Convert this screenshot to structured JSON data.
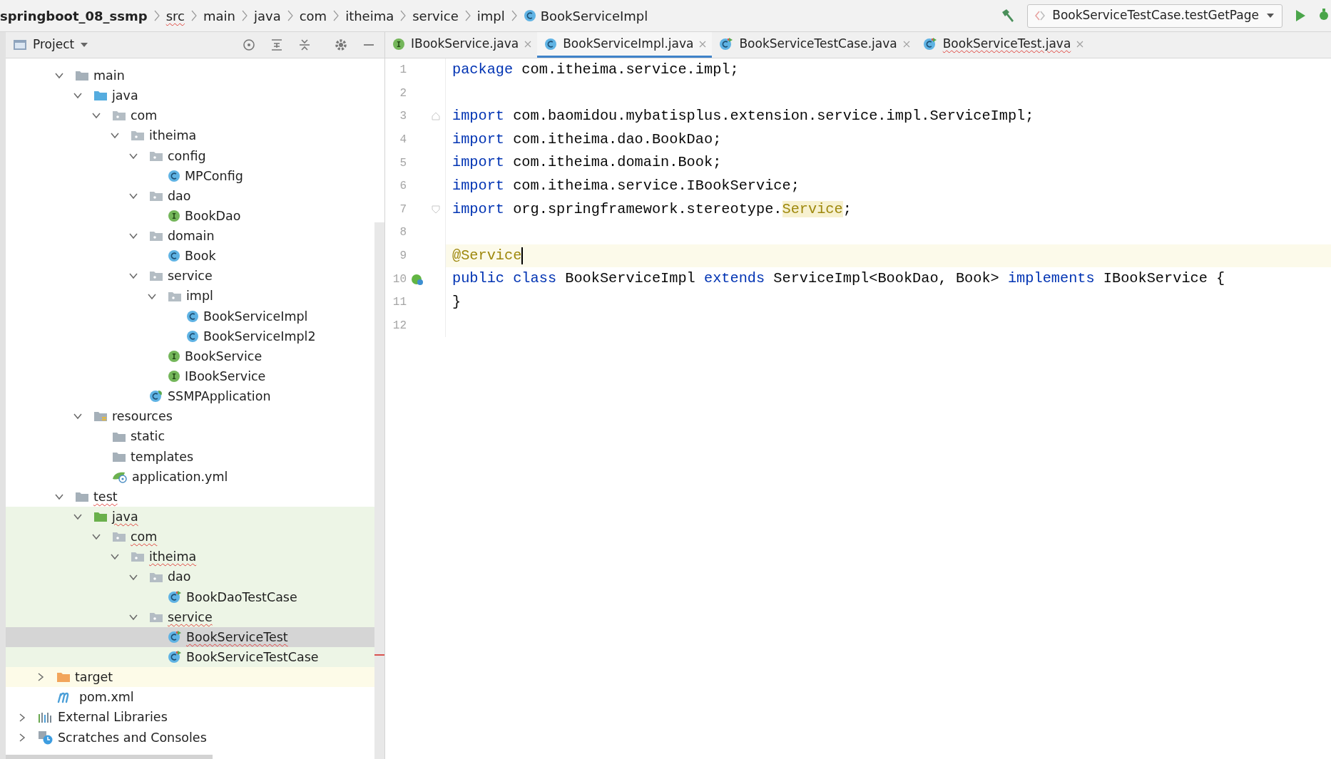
{
  "breadcrumb": {
    "items": [
      {
        "label": "springboot_08_ssmp",
        "kind": "module",
        "underlined": false
      },
      {
        "label": "src",
        "kind": "dir",
        "underlined": true
      },
      {
        "label": "main",
        "kind": "dir",
        "underlined": false
      },
      {
        "label": "java",
        "kind": "dir",
        "underlined": false
      },
      {
        "label": "com",
        "kind": "dir",
        "underlined": false
      },
      {
        "label": "itheima",
        "kind": "dir",
        "underlined": false
      },
      {
        "label": "service",
        "kind": "dir",
        "underlined": false
      },
      {
        "label": "impl",
        "kind": "dir",
        "underlined": false
      },
      {
        "label": "BookServiceImpl",
        "kind": "class",
        "underlined": false
      }
    ]
  },
  "toolbar": {
    "run_config": "BookServiceTestCase.testGetPage"
  },
  "project_panel": {
    "title": "Project"
  },
  "tabs": [
    {
      "label": "IBookService.java",
      "kind": "interface",
      "selected": false,
      "underlined": false
    },
    {
      "label": "BookServiceImpl.java",
      "kind": "class",
      "selected": true,
      "underlined": false
    },
    {
      "label": "BookServiceTestCase.java",
      "kind": "test-class",
      "selected": false,
      "underlined": false
    },
    {
      "label": "BookServiceTest.java",
      "kind": "test-class",
      "selected": false,
      "underlined": true
    }
  ],
  "tree": {
    "src_children": [
      {
        "label": "main",
        "kind": "folder",
        "expanded": true,
        "selected": false,
        "underlined": false,
        "test_scope": false,
        "children": [
          {
            "label": "java",
            "kind": "source-folder",
            "expanded": true,
            "selected": false,
            "underlined": false,
            "children": [
              {
                "label": "com",
                "kind": "package",
                "expanded": true,
                "selected": false,
                "underlined": false,
                "children": [
                  {
                    "label": "itheima",
                    "kind": "package",
                    "expanded": true,
                    "selected": false,
                    "underlined": false,
                    "children": [
                      {
                        "label": "config",
                        "kind": "package",
                        "expanded": true,
                        "selected": false,
                        "underlined": false,
                        "children": [
                          {
                            "label": "MPConfig",
                            "kind": "class",
                            "selected": false,
                            "underlined": false
                          }
                        ]
                      },
                      {
                        "label": "dao",
                        "kind": "package",
                        "expanded": true,
                        "selected": false,
                        "underlined": false,
                        "children": [
                          {
                            "label": "BookDao",
                            "kind": "interface",
                            "selected": false,
                            "underlined": false
                          }
                        ]
                      },
                      {
                        "label": "domain",
                        "kind": "package",
                        "expanded": true,
                        "selected": false,
                        "underlined": false,
                        "children": [
                          {
                            "label": "Book",
                            "kind": "class",
                            "selected": false,
                            "underlined": false
                          }
                        ]
                      },
                      {
                        "label": "service",
                        "kind": "package",
                        "expanded": true,
                        "selected": false,
                        "underlined": false,
                        "children": [
                          {
                            "label": "impl",
                            "kind": "package",
                            "expanded": true,
                            "selected": false,
                            "underlined": false,
                            "children": [
                              {
                                "label": "BookServiceImpl",
                                "kind": "class",
                                "selected": false,
                                "underlined": false
                              },
                              {
                                "label": "BookServiceImpl2",
                                "kind": "class",
                                "selected": false,
                                "underlined": false
                              }
                            ]
                          },
                          {
                            "label": "BookService",
                            "kind": "interface",
                            "selected": false,
                            "underlined": false
                          },
                          {
                            "label": "IBookService",
                            "kind": "interface",
                            "selected": false,
                            "underlined": false
                          }
                        ]
                      },
                      {
                        "label": "SSMPApplication",
                        "kind": "spring-class",
                        "selected": false,
                        "underlined": false
                      }
                    ]
                  }
                ]
              }
            ]
          },
          {
            "label": "resources",
            "kind": "resources-folder",
            "expanded": true,
            "selected": false,
            "underlined": false,
            "children": [
              {
                "label": "static",
                "kind": "folder",
                "selected": false,
                "underlined": false
              },
              {
                "label": "templates",
                "kind": "folder",
                "selected": false,
                "underlined": false
              },
              {
                "label": "application.yml",
                "kind": "yml",
                "selected": false,
                "underlined": false
              }
            ]
          }
        ]
      },
      {
        "label": "test",
        "kind": "folder",
        "expanded": true,
        "selected": false,
        "underlined": true,
        "test_scope": false,
        "children": [
          {
            "label": "java",
            "kind": "test-folder",
            "expanded": true,
            "selected": false,
            "underlined": true,
            "test_scope": true,
            "children": [
              {
                "label": "com",
                "kind": "package",
                "expanded": true,
                "selected": false,
                "underlined": true,
                "test_scope": true,
                "children": [
                  {
                    "label": "itheima",
                    "kind": "package",
                    "expanded": true,
                    "selected": false,
                    "underlined": true,
                    "test_scope": true,
                    "children": [
                      {
                        "label": "dao",
                        "kind": "package",
                        "expanded": true,
                        "selected": false,
                        "underlined": false,
                        "test_scope": true,
                        "children": [
                          {
                            "label": "BookDaoTestCase",
                            "kind": "test-class",
                            "selected": false,
                            "underlined": false,
                            "test_scope": true
                          }
                        ]
                      },
                      {
                        "label": "service",
                        "kind": "package",
                        "expanded": true,
                        "selected": false,
                        "underlined": true,
                        "test_scope": true,
                        "children": [
                          {
                            "label": "BookServiceTest",
                            "kind": "test-class",
                            "selected": true,
                            "underlined": true,
                            "test_scope": true
                          },
                          {
                            "label": "BookServiceTestCase",
                            "kind": "test-class",
                            "selected": false,
                            "underlined": false,
                            "test_scope": true
                          }
                        ]
                      }
                    ]
                  }
                ]
              }
            ]
          }
        ]
      }
    ],
    "module_items": [
      {
        "label": "target",
        "kind": "excluded-folder",
        "expanded": false,
        "selected": false,
        "underlined": false,
        "excluded": true
      },
      {
        "label": "pom.xml",
        "kind": "maven",
        "selected": false,
        "underlined": false,
        "excluded": false
      }
    ],
    "root_items": [
      {
        "label": "External Libraries",
        "kind": "libraries",
        "expanded": false,
        "selected": false,
        "underlined": false
      },
      {
        "label": "Scratches and Consoles",
        "kind": "scratches",
        "expanded": false,
        "selected": false,
        "underlined": false
      }
    ]
  },
  "editor": {
    "lines": [
      {
        "number": "1",
        "current": false,
        "tokens": [
          {
            "text": "package",
            "kind": "keyword"
          },
          {
            "text": " com.itheima.service.impl;",
            "kind": "plain"
          }
        ]
      },
      {
        "number": "2",
        "current": false
      },
      {
        "number": "3",
        "current": false,
        "fold_start": true,
        "tokens": [
          {
            "text": "import",
            "kind": "keyword"
          },
          {
            "text": " com.baomidou.mybatisplus.extension.service.impl.ServiceImpl;",
            "kind": "plain"
          }
        ]
      },
      {
        "number": "4",
        "current": false,
        "tokens": [
          {
            "text": "import",
            "kind": "keyword"
          },
          {
            "text": " com.itheima.dao.BookDao;",
            "kind": "plain"
          }
        ]
      },
      {
        "number": "5",
        "current": false,
        "tokens": [
          {
            "text": "import",
            "kind": "keyword"
          },
          {
            "text": " com.itheima.domain.Book;",
            "kind": "plain"
          }
        ]
      },
      {
        "number": "6",
        "current": false,
        "tokens": [
          {
            "text": "import",
            "kind": "keyword"
          },
          {
            "text": " com.itheima.service.IBookService;",
            "kind": "plain"
          }
        ]
      },
      {
        "number": "7",
        "current": false,
        "fold_end": true,
        "tokens": [
          {
            "text": "import",
            "kind": "keyword"
          },
          {
            "text": " org.springframework.stereotype.",
            "kind": "plain"
          },
          {
            "text": "Service",
            "kind": "highlighted-annotation"
          },
          {
            "text": ";",
            "kind": "plain"
          }
        ]
      },
      {
        "number": "8",
        "current": false
      },
      {
        "number": "9",
        "current": true,
        "caret": true,
        "tokens": [
          {
            "text": "@Service",
            "kind": "annotation"
          }
        ]
      },
      {
        "number": "10",
        "current": false,
        "gutter_icon": true,
        "tokens": [
          {
            "text": "public class",
            "kind": "keyword"
          },
          {
            "text": " BookServiceImpl ",
            "kind": "plain"
          },
          {
            "text": "extends",
            "kind": "keyword"
          },
          {
            "text": " ServiceImpl<BookDao, Book> ",
            "kind": "plain"
          },
          {
            "text": "implements",
            "kind": "keyword"
          },
          {
            "text": " IBookService {",
            "kind": "plain"
          }
        ]
      },
      {
        "number": "11",
        "current": false,
        "tokens": [
          {
            "text": "}",
            "kind": "plain"
          }
        ]
      },
      {
        "number": "12",
        "current": false
      }
    ]
  }
}
